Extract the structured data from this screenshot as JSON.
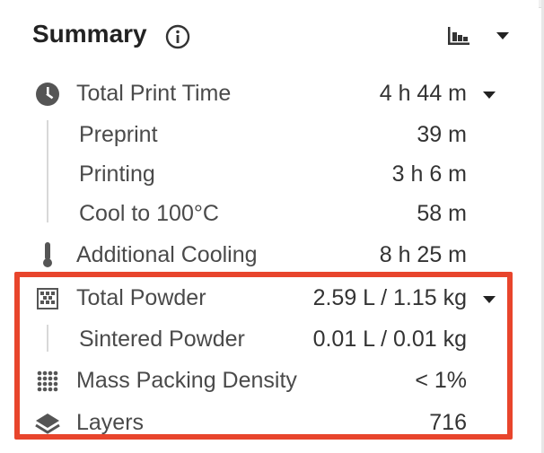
{
  "header": {
    "title": "Summary"
  },
  "rows": [
    {
      "label": "Total Print Time",
      "value": "4 h 44 m"
    },
    {
      "label": "Preprint",
      "value": "39 m"
    },
    {
      "label": "Printing",
      "value": "3 h 6 m"
    },
    {
      "label": "Cool to 100°C",
      "value": "58 m"
    },
    {
      "label": "Additional Cooling",
      "value": "8 h 25 m"
    },
    {
      "label": "Total Powder",
      "value": "2.59 L / 1.15 kg"
    },
    {
      "label": "Sintered Powder",
      "value": "0.01 L / 0.01 kg"
    },
    {
      "label": "Mass Packing Density",
      "value": "< 1%"
    },
    {
      "label": "Layers",
      "value": "716"
    }
  ],
  "icons": {
    "info": "info-icon",
    "chart": "bar-chart-icon",
    "time": "clock-icon",
    "cooling": "thermometer-icon",
    "powder": "powder-grid-icon",
    "density": "dot-grid-icon",
    "layers": "layers-icon"
  },
  "colors": {
    "highlight": "#e8452c",
    "text": "#4a4a4a",
    "title": "#222222",
    "icon": "#555555"
  }
}
